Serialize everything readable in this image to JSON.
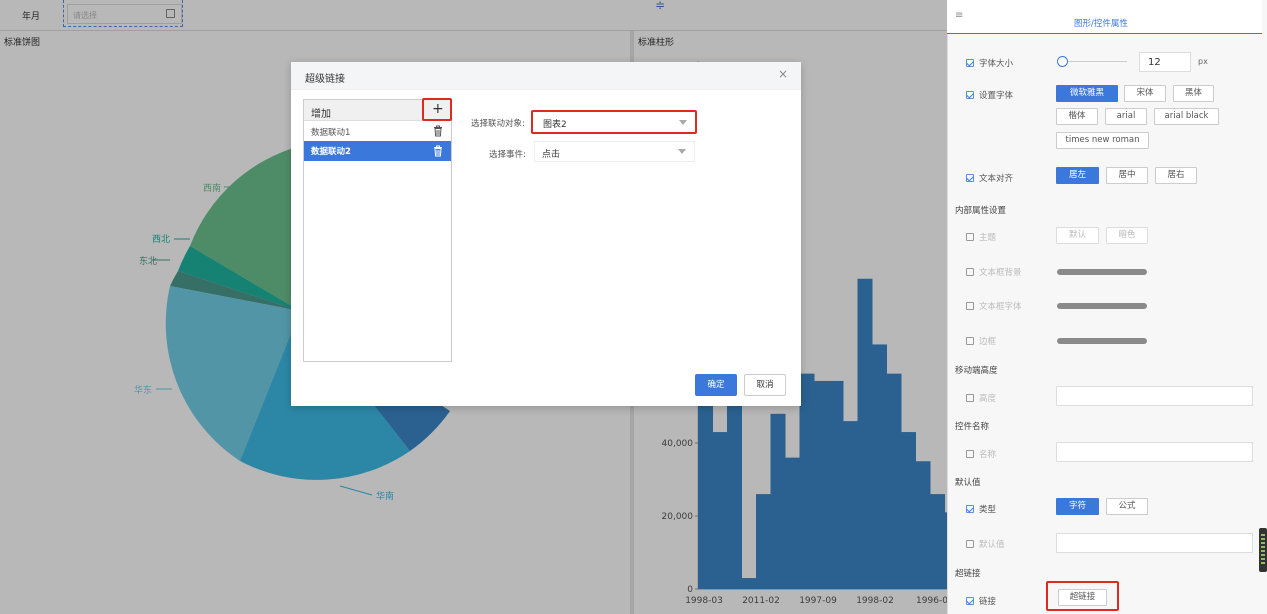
{
  "topbar": {
    "field_label": "年月",
    "date_placeholder": "请选择"
  },
  "pie_panel": {
    "title": "标准饼图",
    "labels": [
      "西南",
      "西北",
      "东北",
      "华东",
      "华南"
    ]
  },
  "bar_panel": {
    "title": "标准柱形"
  },
  "colors": {
    "accent": "#3a78db",
    "highlight": "#e02a20",
    "bar": "#3b87c8"
  },
  "chart_data": {
    "type": "bar",
    "title": "标准柱形",
    "x_tick_labels": [
      "1998-03",
      "2011-02",
      "1997-09",
      "1998-02",
      "1996-0"
    ],
    "y_tick_labels": [
      "0",
      "20,000",
      "40,000"
    ],
    "ylim": [
      0,
      40000
    ],
    "values": [
      51000,
      43000,
      57000,
      3000,
      26000,
      48000,
      36000,
      59000,
      57000,
      57000,
      46000,
      85000,
      67000,
      59000,
      43000,
      35000,
      26000,
      21000
    ],
    "note": "bars partially hidden by dialog"
  },
  "dialog": {
    "title": "超级链接",
    "list_header": "增加",
    "items": [
      {
        "label": "数据联动1"
      },
      {
        "label": "数据联动2"
      }
    ],
    "target_label": "选择联动对象:",
    "target_value": "图表2",
    "event_label": "选择事件:",
    "event_value": "点击",
    "ok": "确定",
    "cancel": "取消"
  },
  "props": {
    "tab_title": "图形/控件属性",
    "font_size_label": "字体大小",
    "font_size_value": "12",
    "font_size_unit": "px",
    "font_set_label": "设置字体",
    "fonts": [
      "微软雅黑",
      "宋体",
      "黑体",
      "楷体",
      "arial",
      "arial black",
      "times new roman"
    ],
    "align_label": "文本对齐",
    "aligns": [
      "居左",
      "居中",
      "居右"
    ],
    "inner_section": "内部属性设置",
    "theme_label": "主题",
    "themes": [
      "默认",
      "暗色"
    ],
    "textbox_bg_label": "文本框背景",
    "textbox_font_label": "文本框字体",
    "border_label": "边框",
    "mobile_section": "移动端高度",
    "height_label": "高度",
    "name_section": "控件名称",
    "name_label": "名称",
    "default_section": "默认值",
    "type_label": "类型",
    "types": [
      "字符",
      "公式"
    ],
    "default_value_label": "默认值",
    "link_section": "超链接",
    "link_label": "链接",
    "link_button": "超链接"
  }
}
